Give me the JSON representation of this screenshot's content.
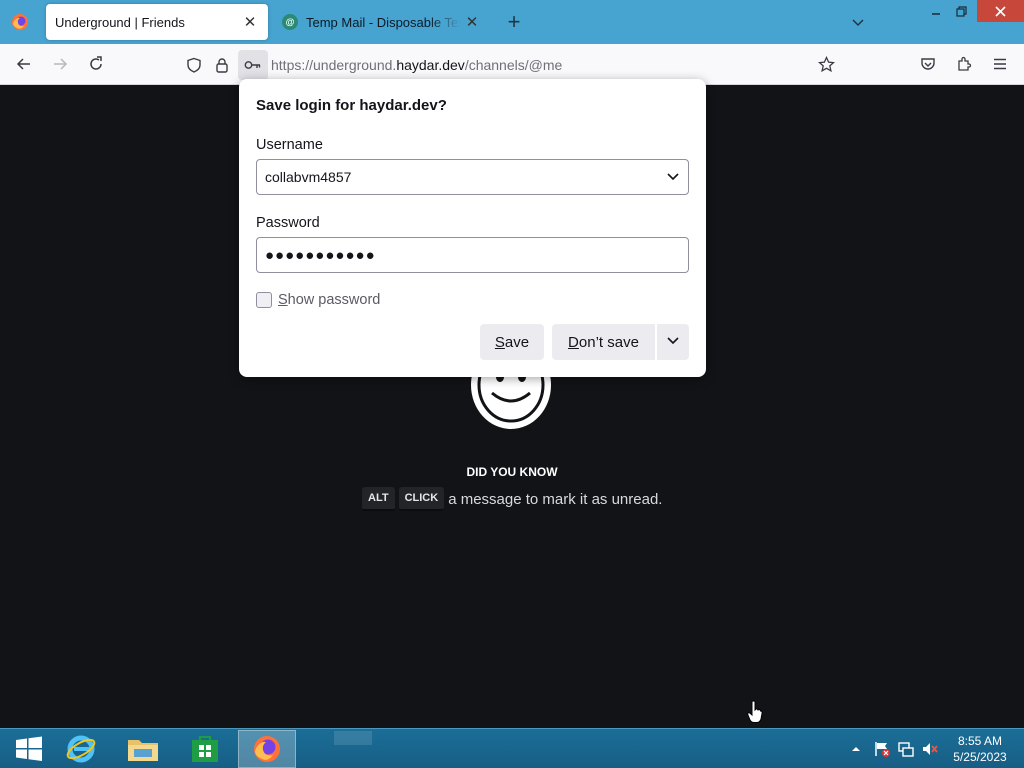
{
  "browser": {
    "tabs": [
      {
        "title": "Underground | Friends",
        "active": true
      },
      {
        "title": "Temp Mail - Disposable Temporary Email",
        "active": false
      }
    ],
    "new_tab_symbol": "+",
    "url": {
      "prefix": "https://underground.",
      "domain": "haydar.dev",
      "suffix": "/channels/@me"
    }
  },
  "popup": {
    "title": "Save login for haydar.dev?",
    "username_label": "Username",
    "username_value": "collabvm4857",
    "password_label": "Password",
    "password_masked": "●●●●●●●●●●●",
    "show_password_label": {
      "accesskey": "S",
      "rest": "how password"
    },
    "save_button": {
      "accesskey": "S",
      "rest": "ave"
    },
    "dont_save_button": {
      "accesskey": "D",
      "rest": "on’t save"
    }
  },
  "page": {
    "did_you_know_title": "DID YOU KNOW",
    "keys": [
      "ALT",
      "CLICK"
    ],
    "tip_text": "a message to mark it as unread."
  },
  "taskbar": {
    "time": "8:55 AM",
    "date": "5/25/2023"
  },
  "colors": {
    "tabstrip": "#47a3d0",
    "page_bg": "#121317",
    "taskbar": "#1b6e98",
    "close_button": "#c7473a"
  }
}
